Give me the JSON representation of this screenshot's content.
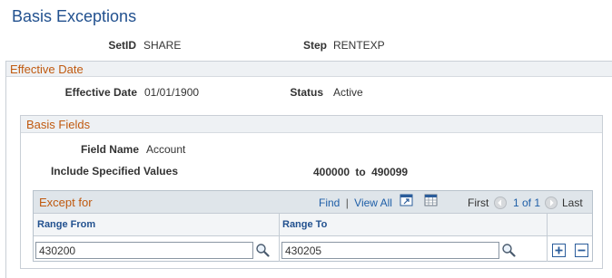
{
  "page": {
    "title": "Basis Exceptions"
  },
  "header": {
    "setid_label": "SetID",
    "setid_value": "SHARE",
    "step_label": "Step",
    "step_value": "RENTEXP"
  },
  "effective_date": {
    "section_title": "Effective Date",
    "date_label": "Effective Date",
    "date_value": "01/01/1900",
    "status_label": "Status",
    "status_value": "Active"
  },
  "basis_fields": {
    "section_title": "Basis Fields",
    "field_name_label": "Field Name",
    "field_name_value": "Account",
    "include_label": "Include Specified Values",
    "range_from": "400000",
    "range_word": "to",
    "range_to": "490099"
  },
  "except_for": {
    "title": "Except for",
    "find_label": "Find",
    "separator": "|",
    "view_all_label": "View All",
    "first_label": "First",
    "pager_text": "1 of 1",
    "last_label": "Last",
    "columns": {
      "range_from": "Range From",
      "range_to": "Range To"
    },
    "rows": [
      {
        "range_from": "430200",
        "range_to": "430205"
      }
    ]
  },
  "colors": {
    "accent": "#22518f",
    "section_title": "#c05a10",
    "link": "#1f5fa8"
  },
  "icons": [
    "lookup-icon",
    "add-row-icon",
    "delete-row-icon",
    "zoom-icon",
    "download-icon",
    "prev-icon",
    "next-icon"
  ]
}
